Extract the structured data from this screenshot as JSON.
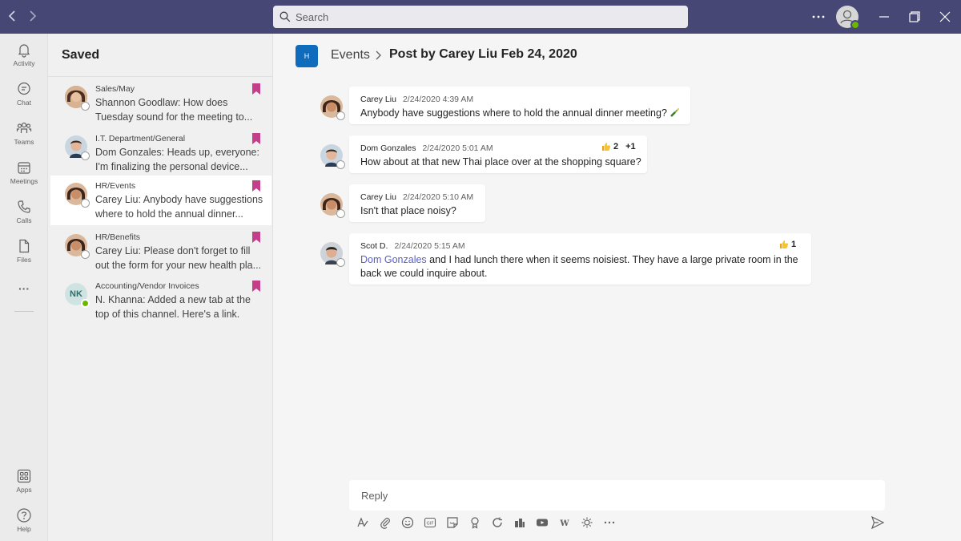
{
  "search": {
    "placeholder": "Search"
  },
  "rail": {
    "items": [
      {
        "label": "Activity",
        "icon": "bell-icon"
      },
      {
        "label": "Chat",
        "icon": "chat-icon"
      },
      {
        "label": "Teams",
        "icon": "teams-icon"
      },
      {
        "label": "Meetings",
        "icon": "calendar-icon"
      },
      {
        "label": "Calls",
        "icon": "phone-icon"
      },
      {
        "label": "Files",
        "icon": "file-icon"
      }
    ],
    "more": "···",
    "apps_label": "Apps",
    "help_label": "Help"
  },
  "saved": {
    "title": "Saved",
    "items": [
      {
        "channel": "Sales/May",
        "preview": "Shannon Goodlaw: How does Tuesday sound for the meeting to...",
        "selected": false
      },
      {
        "channel": "I.T. Department/General",
        "preview": "Dom Gonzales: Heads up, everyone: I'm finalizing the personal device...",
        "selected": false
      },
      {
        "channel": "HR/Events",
        "preview": "Carey Liu: Anybody have suggestions where to hold the annual dinner...",
        "selected": true
      },
      {
        "channel": "HR/Benefits",
        "preview": "Carey Liu: Please don't forget to fill out the form for your new health pla...",
        "selected": false
      },
      {
        "channel": "Accounting/Vendor Invoices",
        "preview": "N. Khanna: Added a new tab at the top of this channel. Here's a link.",
        "initials": "NK",
        "selected": false
      }
    ]
  },
  "breadcrumb": {
    "tile": "H",
    "parent": "Events",
    "current": "Post by Carey Liu Feb 24, 2020"
  },
  "messages": [
    {
      "author": "Carey Liu",
      "time": "2/24/2020 4:39 AM",
      "body": "Anybody have suggestions where to hold the annual dinner meeting?"
    },
    {
      "author": "Dom Gonzales",
      "time": "2/24/2020 5:01 AM",
      "body": "How about at that new Thai place over at the shopping square?",
      "reaction_count": "2",
      "reaction_extra": "+1"
    },
    {
      "author": "Carey Liu",
      "time": "2/24/2020 5:10 AM",
      "body": "Isn't that place noisy?"
    },
    {
      "author": "Scot D.",
      "time": "2/24/2020 5:15 AM",
      "mention": "Dom Gonzales",
      "body": " and I had lunch there when it seems noisiest. They have a large private room in the",
      "body2": "back we could inquire about.",
      "reaction_count": "1"
    }
  ],
  "reply": {
    "placeholder": "Reply"
  },
  "colors": {
    "titlebar": "#464775",
    "accent": "#5b5fc7",
    "bookmark": "#c43e8a",
    "presence": "#6bb700"
  }
}
